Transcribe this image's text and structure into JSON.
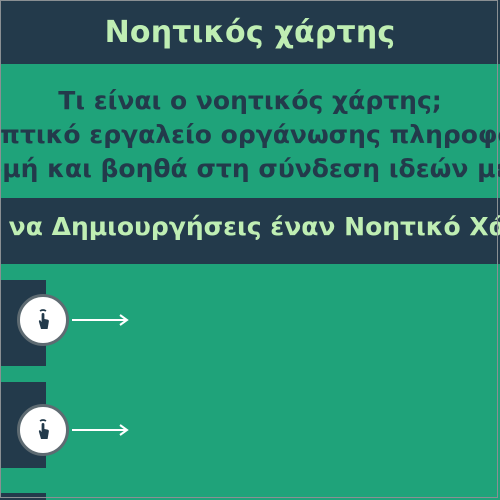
{
  "header": {
    "title": "Νοητικός χάρτης"
  },
  "intro": {
    "line1": "Τι είναι ο νοητικός χάρτης;",
    "line2": "Ένα οπτικό εργαλείο οργάνωσης πληροφοριών",
    "line3": "σε δομή και βοηθά στη σύνδεση ιδεών μεταξύ"
  },
  "banner": {
    "text": "Πώς να Δημιουργήσεις έναν Νοητικό Χάρτη"
  },
  "steps": [
    {
      "icon": "tap-hand-icon"
    },
    {
      "icon": "tap-hand-icon"
    }
  ],
  "colors": {
    "background": "#1fa37a",
    "dark": "#233a4b",
    "accent_text": "#bfeeb3"
  }
}
